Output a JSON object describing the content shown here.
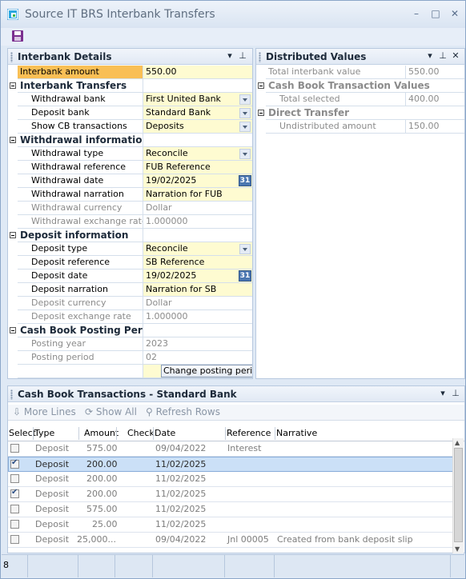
{
  "window": {
    "title": "Source IT BRS Interbank Transfers",
    "controls": {
      "minimize": "–",
      "maximize": "□",
      "close": "✕"
    }
  },
  "interbank_details": {
    "title": "Interbank Details",
    "interbank_amount": {
      "label": "Interbank amount",
      "value": "550.00"
    },
    "interbank_transfers": {
      "title": "Interbank Transfers",
      "withdrawal_bank": {
        "label": "Withdrawal bank",
        "value": "First United Bank"
      },
      "deposit_bank": {
        "label": "Deposit bank",
        "value": "Standard Bank"
      },
      "show_cb": {
        "label": "Show CB transactions",
        "value": "Deposits"
      }
    },
    "withdrawal": {
      "title": "Withdrawal information",
      "type": {
        "label": "Withdrawal type",
        "value": "Reconcile"
      },
      "reference": {
        "label": "Withdrawal reference",
        "value": "FUB Reference"
      },
      "date": {
        "label": "Withdrawal date",
        "value": "19/02/2025"
      },
      "narration": {
        "label": "Withdrawal narration",
        "value": "Narration for FUB"
      },
      "currency": {
        "label": "Withdrawal currency",
        "value": "Dollar"
      },
      "rate": {
        "label": "Withdrawal exchange rate",
        "value": "1.000000"
      }
    },
    "deposit": {
      "title": "Deposit information",
      "type": {
        "label": "Deposit type",
        "value": "Reconcile"
      },
      "reference": {
        "label": "Deposit reference",
        "value": "SB Reference"
      },
      "date": {
        "label": "Deposit date",
        "value": "19/02/2025"
      },
      "narration": {
        "label": "Deposit narration",
        "value": "Narration for SB"
      },
      "currency": {
        "label": "Deposit currency",
        "value": "Dollar"
      },
      "rate": {
        "label": "Deposit exchange rate",
        "value": "1.000000"
      }
    },
    "posting": {
      "title": "Cash Book Posting Period",
      "year": {
        "label": "Posting year",
        "value": "2023"
      },
      "period": {
        "label": "Posting period",
        "value": "02"
      },
      "change_button": "Change posting period"
    },
    "calendar_glyph": "31"
  },
  "distributed_values": {
    "title": "Distributed Values",
    "total_interbank": {
      "label": "Total interbank value",
      "value": "550.00"
    },
    "cash_book": {
      "title": "Cash Book Transaction Values",
      "total_selected": {
        "label": "Total selected",
        "value": "400.00"
      }
    },
    "direct_transfer": {
      "title": "Direct Transfer",
      "undistributed": {
        "label": "Undistributed amount",
        "value": "150.00"
      }
    }
  },
  "cash_book_transactions": {
    "title": "Cash Book Transactions - Standard Bank",
    "toolbar": {
      "more_lines": "More Lines",
      "show_all": "Show All",
      "refresh_rows": "Refresh Rows"
    },
    "columns": [
      "Select",
      "Type",
      "Amount",
      "Check",
      "Date",
      "Reference",
      "Narrative"
    ],
    "rows": [
      {
        "selected": false,
        "type": "Deposit",
        "amount": "575.00",
        "check": "",
        "date": "09/04/2022",
        "reference": "Interest",
        "narrative": ""
      },
      {
        "selected": true,
        "type": "Deposit",
        "amount": "200.00",
        "check": "",
        "date": "11/02/2025",
        "reference": "",
        "narrative": ""
      },
      {
        "selected": false,
        "type": "Deposit",
        "amount": "200.00",
        "check": "",
        "date": "11/02/2025",
        "reference": "",
        "narrative": ""
      },
      {
        "selected": true,
        "type": "Deposit",
        "amount": "200.00",
        "check": "",
        "date": "11/02/2025",
        "reference": "",
        "narrative": ""
      },
      {
        "selected": false,
        "type": "Deposit",
        "amount": "575.00",
        "check": "",
        "date": "11/02/2025",
        "reference": "",
        "narrative": ""
      },
      {
        "selected": false,
        "type": "Deposit",
        "amount": "25.00",
        "check": "",
        "date": "11/02/2025",
        "reference": "",
        "narrative": ""
      },
      {
        "selected": false,
        "type": "Deposit",
        "amount": "25,000...",
        "check": "",
        "date": "09/04/2022",
        "reference": "Jnl 00005",
        "narrative": "Created from bank deposit slip"
      }
    ],
    "status": {
      "count": "8"
    }
  },
  "colors": {
    "selected_field": "#f9bf55",
    "editable_field": "#fefbd1",
    "selected_row": "#cbe0f7"
  }
}
